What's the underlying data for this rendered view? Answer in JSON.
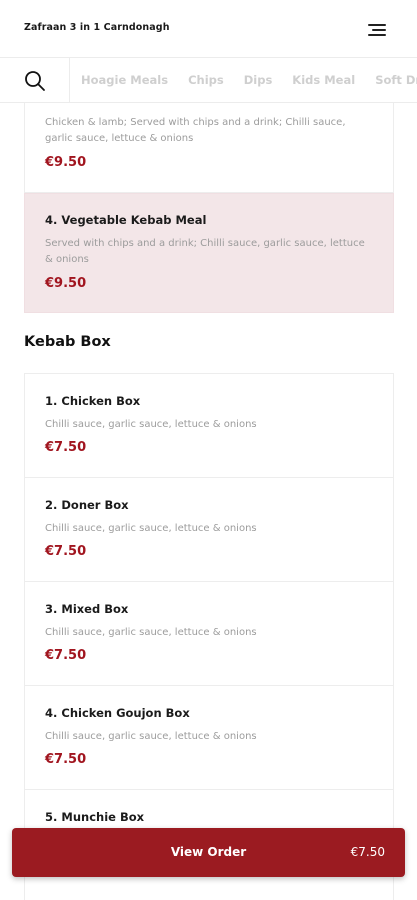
{
  "header": {
    "title": "Zafraan 3 in 1 Carndonagh"
  },
  "category_nav": {
    "items": [
      "Hoagie Meals",
      "Chips",
      "Dips",
      "Kids Meal",
      "Soft Drinks"
    ]
  },
  "meal_items": [
    {
      "description": "Chicken & lamb; Served with chips and a drink; Chilli sauce, garlic sauce, lettuce & onions",
      "price": "€9.50"
    },
    {
      "name": "4. Vegetable Kebab Meal",
      "description": "Served with chips and a drink; Chilli sauce, garlic sauce, lettuce & onions",
      "price": "€9.50"
    }
  ],
  "kebab_box": {
    "title": "Kebab Box",
    "items": [
      {
        "name": "1. Chicken Box",
        "description": "Chilli sauce, garlic sauce, lettuce & onions",
        "price": "€7.50"
      },
      {
        "name": "2. Doner Box",
        "description": "Chilli sauce, garlic sauce, lettuce & onions",
        "price": "€7.50"
      },
      {
        "name": "3. Mixed Box",
        "description": "Chilli sauce, garlic sauce, lettuce & onions",
        "price": "€7.50"
      },
      {
        "name": "4. Chicken Goujon Box",
        "description": "Chilli sauce, garlic sauce, lettuce & onions",
        "price": "€7.50"
      },
      {
        "name": "5. Munchie Box"
      }
    ]
  },
  "order_bar": {
    "label": "View Order",
    "total": "€7.50"
  },
  "colors": {
    "accent": "#9b1b21",
    "price": "#a1151f",
    "highlight_bg": "#f3e6e8"
  }
}
